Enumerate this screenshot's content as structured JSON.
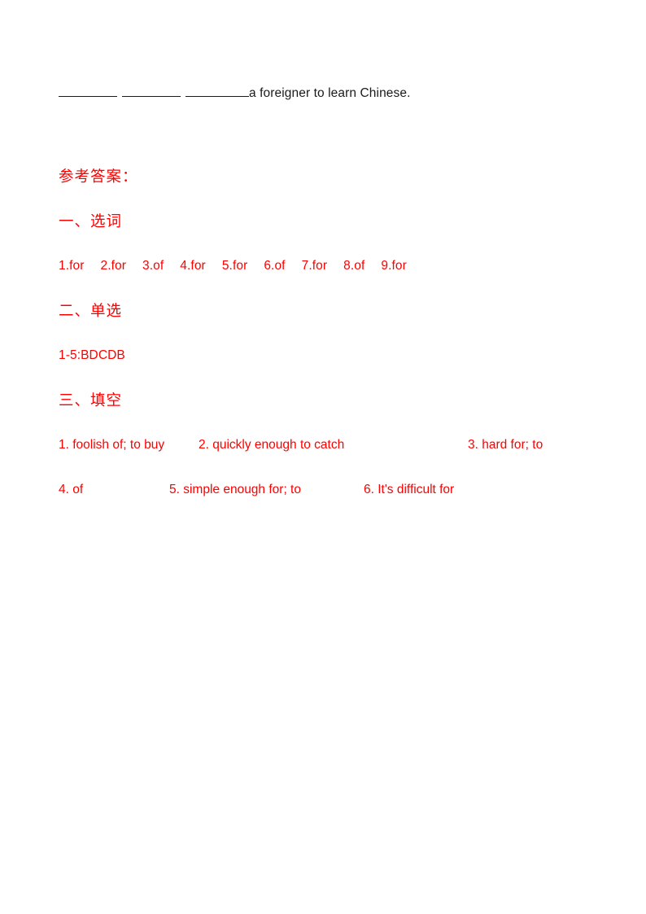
{
  "document": {
    "question_line": {
      "blank_count": 3,
      "trailing_text": "a  foreigner to learn Chinese."
    },
    "answer_key": {
      "title": "参考答案：",
      "sections": [
        {
          "heading": "一、选词",
          "answers": [
            "1.for",
            "2.for",
            "3.of",
            "4.for",
            "5.for",
            "6.of",
            "7.for",
            "8.of",
            "9.for"
          ]
        },
        {
          "heading": "二、单选",
          "answers_line": "1-5:BDCDB"
        },
        {
          "heading": "三、填空",
          "items": [
            "1. foolish of; to buy",
            "2. quickly enough to catch",
            "3. hard for; to",
            "4. of",
            "5. simple enough for; to",
            "6. It's difficult for"
          ]
        }
      ]
    },
    "colors": {
      "answer_red": "#fe0000",
      "body_black": "#1a1a1a",
      "page_background": "#ffffff"
    }
  }
}
